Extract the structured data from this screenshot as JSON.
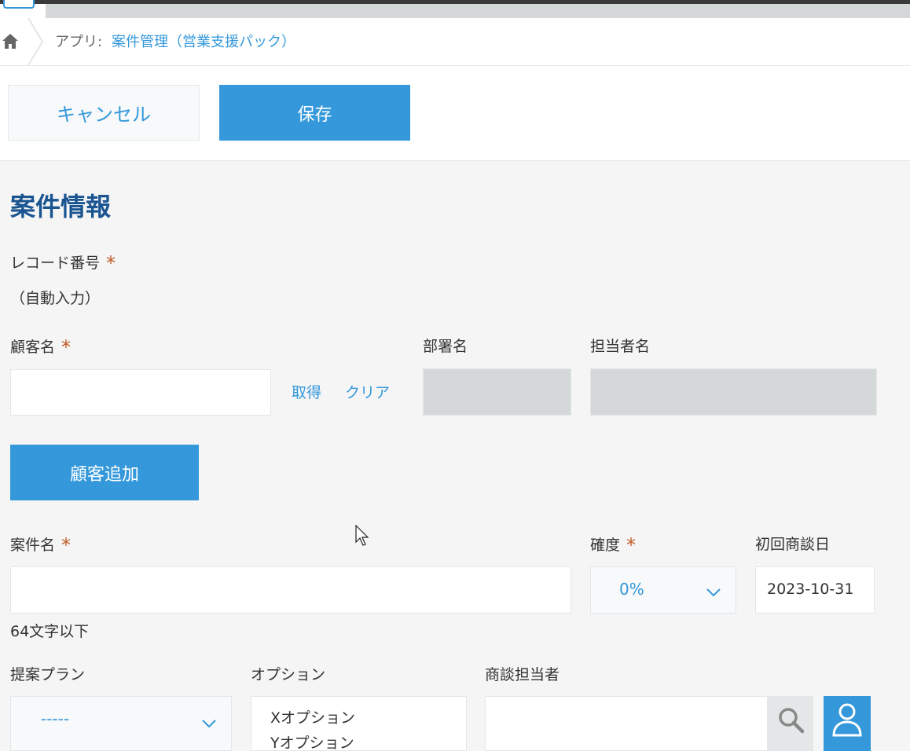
{
  "breadcrumb": {
    "prefix": "アプリ:",
    "app_name": "案件管理（営業支援パック）"
  },
  "toolbar": {
    "cancel_label": "キャンセル",
    "save_label": "保存"
  },
  "section_title": "案件情報",
  "fields": {
    "record_number": {
      "label": "レコード番号",
      "required_mark": "*",
      "value": "（自動入力）"
    },
    "customer_name": {
      "label": "顧客名",
      "required_mark": "*",
      "value": "",
      "fetch_label": "取得",
      "clear_label": "クリア"
    },
    "department": {
      "label": "部署名"
    },
    "contact_person": {
      "label": "担当者名"
    },
    "add_customer_label": "顧客追加",
    "deal_name": {
      "label": "案件名",
      "required_mark": "*",
      "value": "",
      "hint": "64文字以下"
    },
    "probability": {
      "label": "確度",
      "required_mark": "*",
      "selected": "0%"
    },
    "first_meeting_date": {
      "label": "初回商談日",
      "value": "2023-10-31"
    },
    "proposal_plan": {
      "label": "提案プラン",
      "selected": "-----"
    },
    "options": {
      "label": "オプション",
      "items": [
        "Xオプション",
        "Yオプション"
      ]
    },
    "sales_rep": {
      "label": "商談担当者",
      "value": ""
    }
  },
  "colors": {
    "accent": "#3498db",
    "title": "#1a5491",
    "required": "#c05b26",
    "disabled": "#d4d8d9"
  }
}
